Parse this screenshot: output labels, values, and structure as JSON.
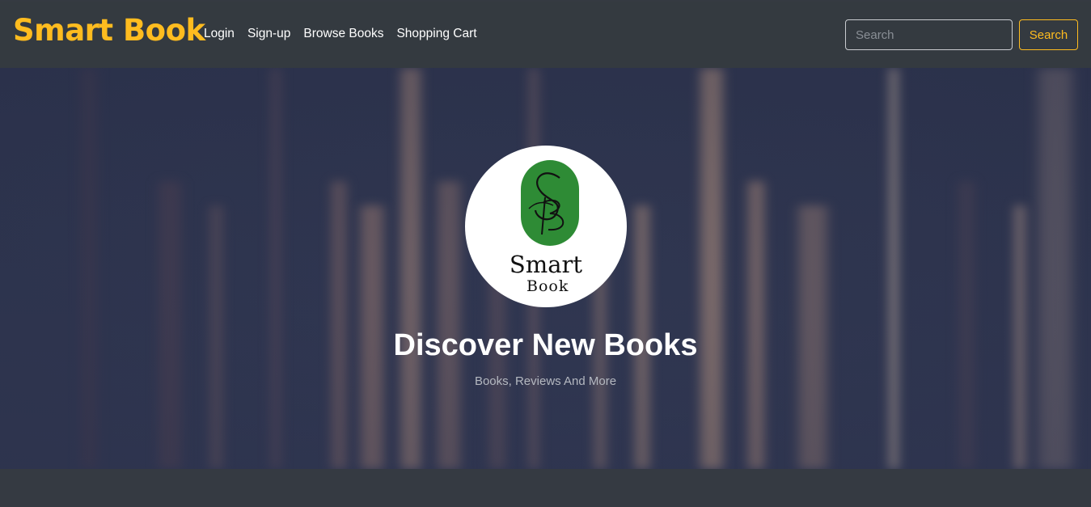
{
  "navbar": {
    "brand": "Smart Book",
    "links": [
      "Login",
      "Sign-up",
      "Browse Books",
      "Shopping Cart"
    ],
    "search": {
      "placeholder": "Search",
      "value": "",
      "button_label": "Search"
    }
  },
  "hero": {
    "logo": {
      "monogram": "SB",
      "line1": "Smart",
      "line2": "Book"
    },
    "title": "Discover New Books",
    "subtitle": "Books, Reviews And More"
  },
  "colors": {
    "accent": "#ffbc1f",
    "navbar_bg": "#343a40",
    "logo_green": "#2e8b35"
  }
}
